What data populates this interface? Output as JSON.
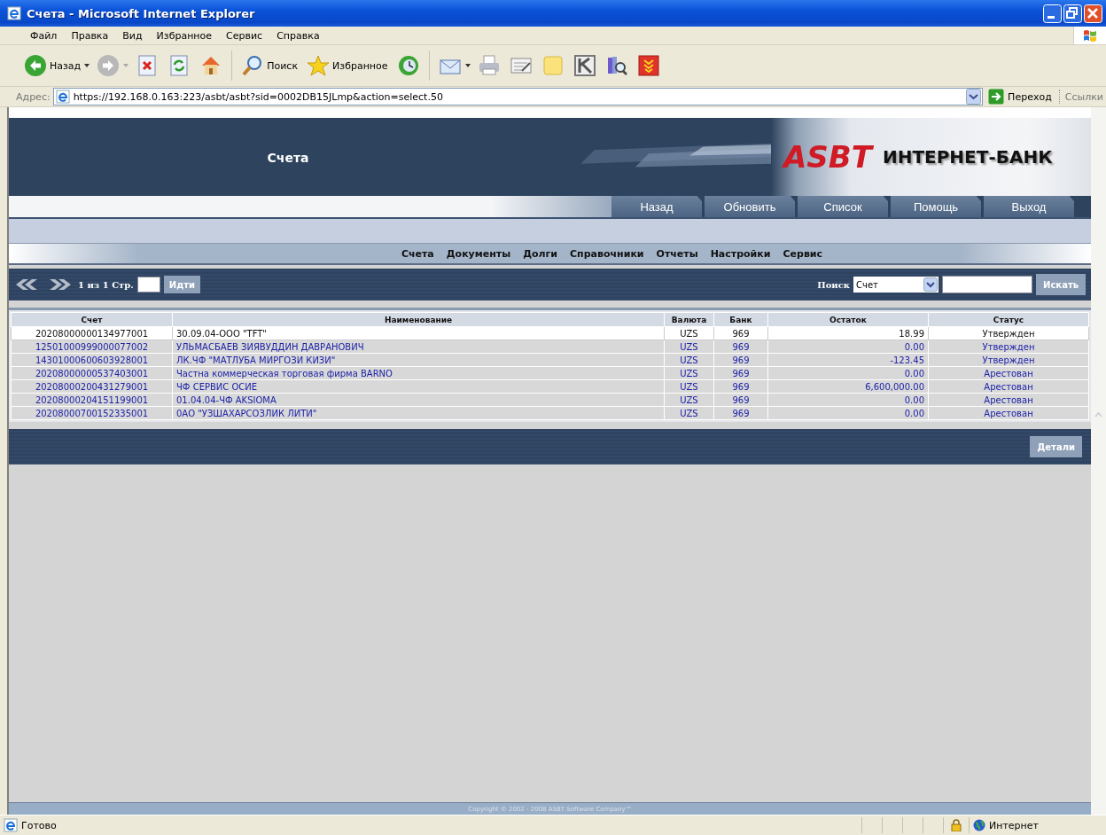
{
  "window": {
    "title": "Счета - Microsoft Internet Explorer"
  },
  "menu": [
    "Файл",
    "Правка",
    "Вид",
    "Избранное",
    "Сервис",
    "Справка"
  ],
  "toolbar": [
    {
      "kind": "back",
      "label": "Назад",
      "dropdown": true
    },
    {
      "kind": "forward",
      "dropdown": true
    },
    {
      "kind": "stop"
    },
    {
      "kind": "refresh"
    },
    {
      "kind": "home"
    },
    {
      "kind": "separator"
    },
    {
      "kind": "search",
      "label": "Поиск"
    },
    {
      "kind": "favorites",
      "label": "Избранное"
    },
    {
      "kind": "history"
    },
    {
      "kind": "separator"
    },
    {
      "kind": "mail",
      "dropdown": true
    },
    {
      "kind": "print"
    },
    {
      "kind": "edit"
    },
    {
      "kind": "note"
    },
    {
      "kind": "k"
    },
    {
      "kind": "research"
    },
    {
      "kind": "download"
    }
  ],
  "address": {
    "label": "Адрес:",
    "url": "https://192.168.0.163:223/asbt/asbt?sid=0002DB15JLmp&action=select.50",
    "go": "Переход",
    "links": "Ссылки"
  },
  "page": {
    "title": "Счета",
    "logo": "ASBT",
    "logo_subtitle": "ИНТЕРНЕТ-БАНК",
    "actions": [
      "Назад",
      "Обновить",
      "Список",
      "Помощь",
      "Выход"
    ],
    "nav": [
      "Счета",
      "Документы",
      "Долги",
      "Справочники",
      "Отчеты",
      "Настройки",
      "Сервис"
    ],
    "pager": {
      "info": "1 из 1 Стр.",
      "go": "Идти",
      "search_label": "Поиск",
      "search_field": "Счет",
      "search_button": "Искать"
    },
    "table": {
      "columns": [
        "Счет",
        "Наименование",
        "Валюта",
        "Банк",
        "Остаток",
        "Статус"
      ],
      "rows": [
        {
          "selected": true,
          "cells": [
            "20208000000134977001",
            "30.09.04-ООО \"TFT\"",
            "UZS",
            "969",
            "18.99",
            "Утвержден"
          ]
        },
        {
          "selected": false,
          "cells": [
            "12501000999000077002",
            "УЛЬМАСБАЕВ ЗИЯВУДДИН ДАВРАНОВИЧ",
            "UZS",
            "969",
            "0.00",
            "Утвержден"
          ]
        },
        {
          "selected": false,
          "cells": [
            "14301000600603928001",
            "ЛК.ЧФ \"МАТЛУБА МИРГОЗИ КИЗИ\"",
            "UZS",
            "969",
            "-123.45",
            "Утвержден"
          ]
        },
        {
          "selected": false,
          "cells": [
            "20208000000537403001",
            "Частна коммерческая торговая фирма BARNO",
            "UZS",
            "969",
            "0.00",
            "Арестован"
          ]
        },
        {
          "selected": false,
          "cells": [
            "20208000200431279001",
            "ЧФ СЕРВИС ОСИЕ",
            "UZS",
            "969",
            "6,600,000.00",
            "Арестован"
          ]
        },
        {
          "selected": false,
          "cells": [
            "20208000204151199001",
            "01.04.04-ЧФ AKSIOMA",
            "UZS",
            "969",
            "0.00",
            "Арестован"
          ]
        },
        {
          "selected": false,
          "cells": [
            "20208000700152335001",
            "0АО \"УЗШАХАРСОЗЛИК ЛИТИ\"",
            "UZS",
            "969",
            "0.00",
            "Арестован"
          ]
        }
      ]
    },
    "details_button": "Детали",
    "copyright": "Copyright © 2002 - 2008 ASBT Software Company™"
  },
  "status_bar": {
    "text": "Готово",
    "zone": "Интернет"
  }
}
